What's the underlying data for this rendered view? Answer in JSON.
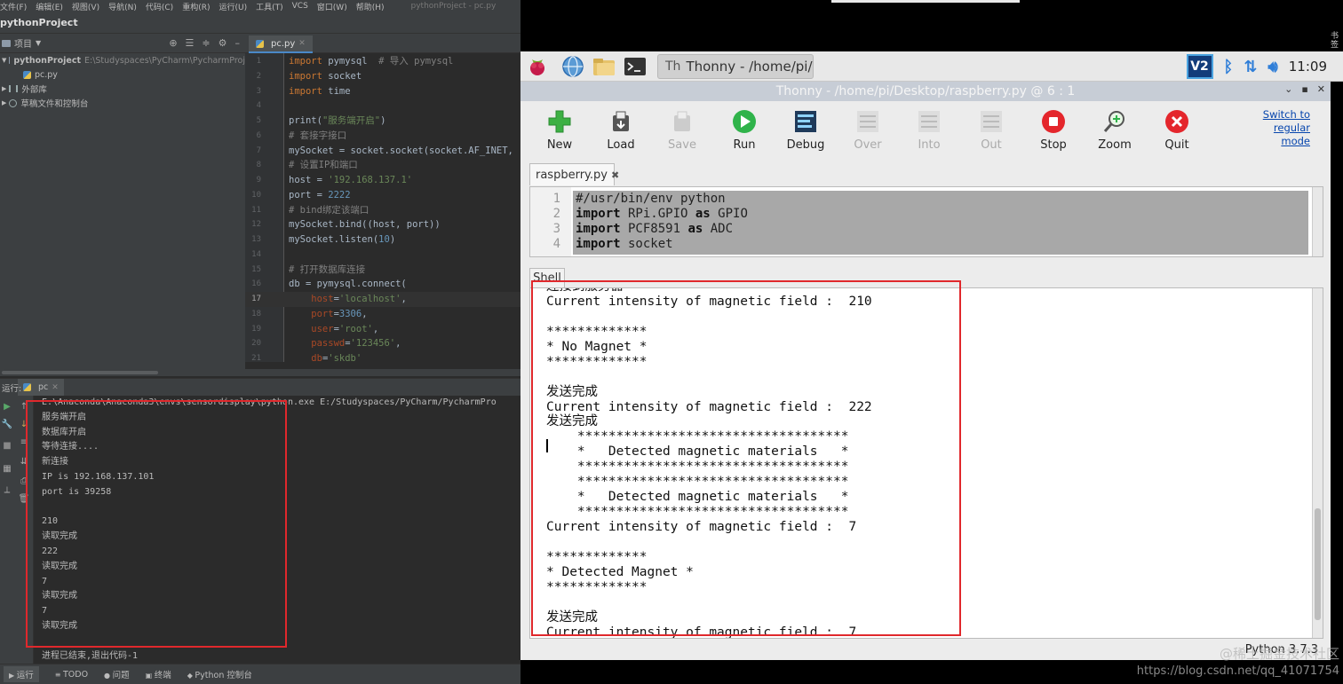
{
  "pycharm": {
    "menu": [
      "文件(F)",
      "编辑(E)",
      "视图(V)",
      "导航(N)",
      "代码(C)",
      "重构(R)",
      "运行(U)",
      "工具(T)",
      "VCS",
      "窗口(W)",
      "帮助(H)"
    ],
    "window_title": "pythonProject - pc.py",
    "project_name": "pythonProject",
    "project_panel_label": "项目",
    "tree": {
      "root_name": "pythonProject",
      "root_path": "E:\\Studyspaces\\PyCharm\\PycharmProj",
      "file": "pc.py",
      "external_libs": "外部库",
      "scratches": "草稿文件和控制台"
    },
    "editor_tab": "pc.py",
    "code_lines": [
      {
        "n": "1",
        "parts": [
          [
            "kw",
            "import"
          ],
          [
            "t",
            " pymysql  "
          ],
          [
            "cm",
            "# 导入 pymysql"
          ]
        ]
      },
      {
        "n": "2",
        "parts": [
          [
            "kw",
            "import"
          ],
          [
            "t",
            " socket"
          ]
        ]
      },
      {
        "n": "3",
        "parts": [
          [
            "kw",
            "import"
          ],
          [
            "t",
            " time"
          ]
        ]
      },
      {
        "n": "4",
        "parts": []
      },
      {
        "n": "5",
        "parts": [
          [
            "t",
            "print("
          ],
          [
            "str",
            "\"服务端开启\""
          ],
          [
            "t",
            ")"
          ]
        ]
      },
      {
        "n": "6",
        "parts": [
          [
            "cm",
            "# 套接字接口"
          ]
        ]
      },
      {
        "n": "7",
        "parts": [
          [
            "t",
            "mySocket = socket.socket(socket.AF_INET,"
          ]
        ]
      },
      {
        "n": "8",
        "parts": [
          [
            "cm",
            "# 设置IP和端口"
          ]
        ]
      },
      {
        "n": "9",
        "parts": [
          [
            "t",
            "host = "
          ],
          [
            "str",
            "'192.168.137.1'"
          ]
        ]
      },
      {
        "n": "10",
        "parts": [
          [
            "t",
            "port = "
          ],
          [
            "num",
            "2222"
          ]
        ]
      },
      {
        "n": "11",
        "parts": [
          [
            "cm",
            "# bind绑定该端口"
          ]
        ]
      },
      {
        "n": "12",
        "parts": [
          [
            "t",
            "mySocket.bind((host, port))"
          ]
        ]
      },
      {
        "n": "13",
        "parts": [
          [
            "t",
            "mySocket.listen("
          ],
          [
            "num",
            "10"
          ],
          [
            "t",
            ")"
          ]
        ]
      },
      {
        "n": "14",
        "parts": []
      },
      {
        "n": "15",
        "parts": [
          [
            "cm",
            "# 打开数据库连接"
          ]
        ]
      },
      {
        "n": "16",
        "parts": [
          [
            "t",
            "db = pymysql.connect("
          ]
        ]
      },
      {
        "n": "17",
        "parts": [
          [
            "kwarg",
            "    host"
          ],
          [
            "t",
            "="
          ],
          [
            "str",
            "'localhost'"
          ],
          [
            "t",
            ","
          ]
        ],
        "current": true
      },
      {
        "n": "18",
        "parts": [
          [
            "kwarg",
            "    port"
          ],
          [
            "t",
            "="
          ],
          [
            "num",
            "3306"
          ],
          [
            "t",
            ","
          ]
        ]
      },
      {
        "n": "19",
        "parts": [
          [
            "kwarg",
            "    user"
          ],
          [
            "t",
            "="
          ],
          [
            "str",
            "'root'"
          ],
          [
            "t",
            ","
          ]
        ]
      },
      {
        "n": "20",
        "parts": [
          [
            "kwarg",
            "    passwd"
          ],
          [
            "t",
            "="
          ],
          [
            "str",
            "'123456'"
          ],
          [
            "t",
            ","
          ]
        ]
      },
      {
        "n": "21",
        "parts": [
          [
            "kwarg",
            "    db"
          ],
          [
            "t",
            "="
          ],
          [
            "str",
            "'skdb'"
          ]
        ]
      }
    ],
    "run_label": "运行:",
    "run_tab": "pc",
    "console_lines": [
      "E:\\Anaconda\\Anaconda3\\envs\\sensordisplay\\python.exe E:/Studyspaces/PyCharm/PycharmPro",
      "服务端开启",
      "数据库开启",
      "等待连接....",
      "新连接",
      "IP is 192.168.137.101",
      "port is 39258",
      "",
      "210",
      "读取完成",
      "222",
      "读取完成",
      "7",
      "读取完成",
      "7",
      "读取完成",
      "",
      "进程已结束,退出代码-1"
    ],
    "statusbar": [
      "运行",
      "TODO",
      "问题",
      "终端",
      "Python 控制台"
    ]
  },
  "rpi": {
    "taskbar_item": "Thonny  -  /home/pi/...",
    "clock": "11:09",
    "vnc_label": "V2",
    "side_text": "书签"
  },
  "thonny": {
    "title": "Thonny  -  /home/pi/Desktop/raspberry.py  @  6 : 1",
    "toolbar": [
      {
        "label": "New",
        "icon": "new-icon",
        "enabled": true
      },
      {
        "label": "Load",
        "icon": "load-icon",
        "enabled": true
      },
      {
        "label": "Save",
        "icon": "save-icon",
        "enabled": false
      },
      {
        "label": "Run",
        "icon": "run-icon",
        "enabled": true
      },
      {
        "label": "Debug",
        "icon": "debug-icon",
        "enabled": true
      },
      {
        "label": "Over",
        "icon": "step-over-icon",
        "enabled": false
      },
      {
        "label": "Into",
        "icon": "step-into-icon",
        "enabled": false
      },
      {
        "label": "Out",
        "icon": "step-out-icon",
        "enabled": false
      },
      {
        "label": "Stop",
        "icon": "stop-icon",
        "enabled": true
      },
      {
        "label": "Zoom",
        "icon": "zoom-icon",
        "enabled": true
      },
      {
        "label": "Quit",
        "icon": "quit-icon",
        "enabled": true
      }
    ],
    "switch_mode": "Switch to regular mode",
    "editor_tab": "raspberry.py",
    "editor_lines": [
      {
        "n": "1",
        "parts": [
          [
            "t",
            "#/usr/bin/env python"
          ]
        ]
      },
      {
        "n": "2",
        "parts": [
          [
            "k",
            "import"
          ],
          [
            "t",
            " RPi.GPIO "
          ],
          [
            "k",
            "as"
          ],
          [
            "t",
            " GPIO"
          ]
        ]
      },
      {
        "n": "3",
        "parts": [
          [
            "k",
            "import"
          ],
          [
            "t",
            " PCF8591 "
          ],
          [
            "k",
            "as"
          ],
          [
            "t",
            " ADC"
          ]
        ]
      },
      {
        "n": "4",
        "parts": [
          [
            "k",
            "import"
          ],
          [
            "t",
            " socket"
          ]
        ]
      }
    ],
    "shell_tab": "Shell",
    "shell_lines": [
      "连接到服务器",
      "Current intensity of magnetic field :  210",
      "",
      "*************",
      "* No Magnet *",
      "*************",
      "",
      "发送完成",
      "Current intensity of magnetic field :  222",
      "发送完成",
      "    ***********************************",
      "    *   Detected magnetic materials   *",
      "    ***********************************",
      "    ***********************************",
      "    *   Detected magnetic materials   *",
      "    ***********************************",
      "Current intensity of magnetic field :  7",
      "",
      "*************",
      "* Detected Magnet *",
      "*************",
      "",
      "发送完成",
      "Current intensity of magnetic field :  7"
    ],
    "interpreter": "Python 3.7.3"
  },
  "watermark": {
    "line1": "@稀土掘金技术社区",
    "line2": "https://blog.csdn.net/qq_41071754"
  }
}
